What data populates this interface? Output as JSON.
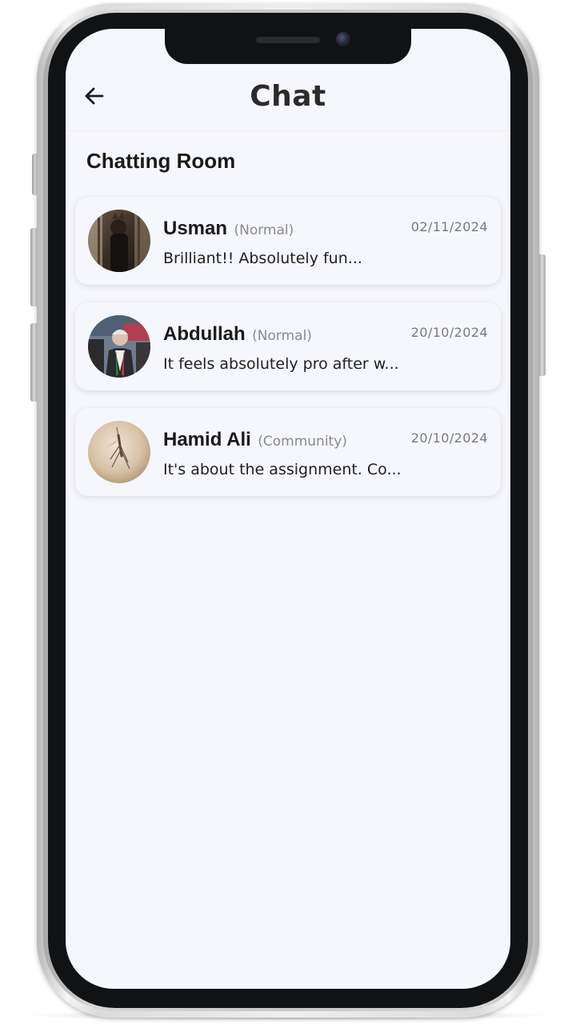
{
  "header": {
    "title": "Chat",
    "back_icon": "arrow-left-icon"
  },
  "section": {
    "heading": "Chatting Room"
  },
  "chats": [
    {
      "name": "Usman",
      "role": "(Normal)",
      "date": "02/11/2024",
      "preview": "Brilliant!! Absolutely fun..."
    },
    {
      "name": "Abdullah",
      "role": "(Normal)",
      "date": "20/10/2024",
      "preview": "It feels absolutely pro after w..."
    },
    {
      "name": "Hamid Ali",
      "role": "(Community)",
      "date": "20/10/2024",
      "preview": "It's about the assignment. Co..."
    }
  ],
  "colors": {
    "screen_background": "#f6f7fc",
    "text_primary": "#1a1a1a",
    "text_secondary": "#8a8a8a",
    "phone_bezel": "#111214"
  }
}
